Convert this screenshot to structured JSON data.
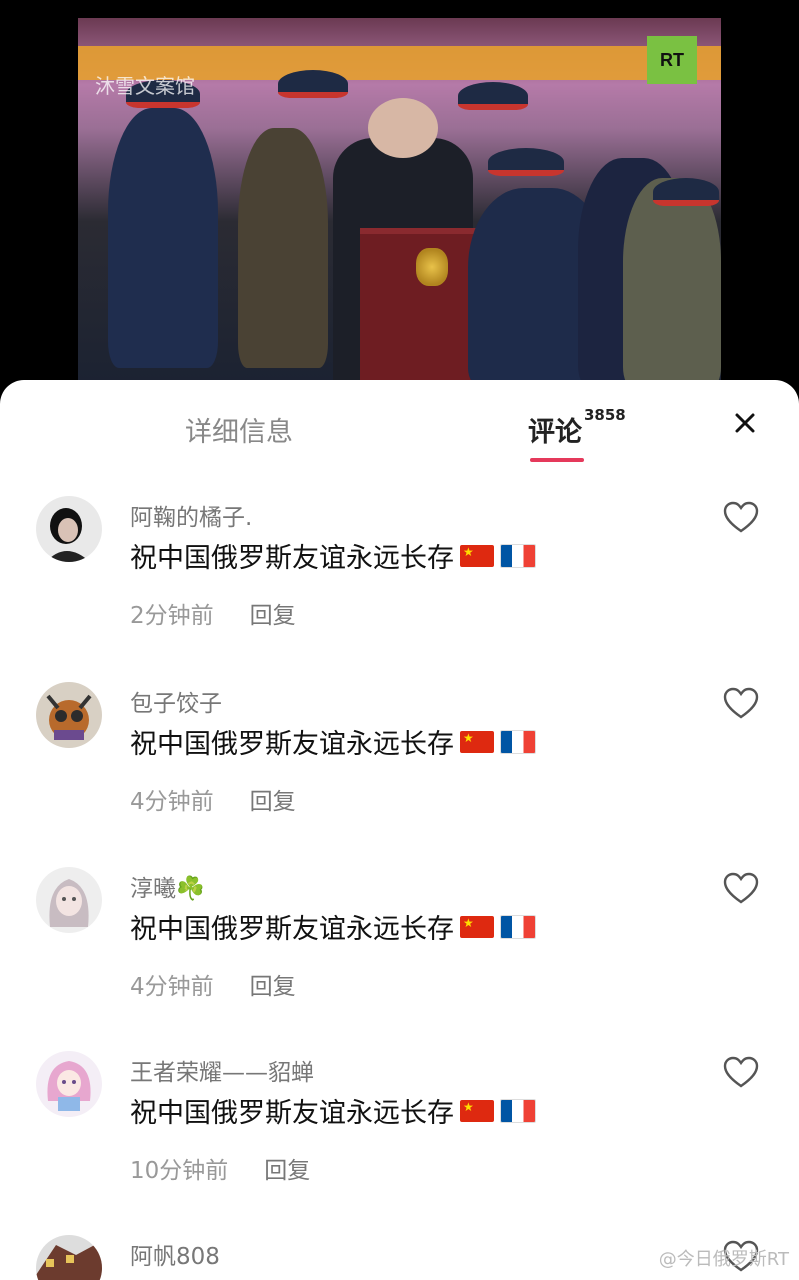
{
  "video": {
    "watermark": "沐雪文案馆",
    "logo": "RT"
  },
  "tabs": {
    "details_label": "详细信息",
    "comments_label": "评论",
    "comments_count": "3858"
  },
  "comments": [
    {
      "username": "阿鞠的橘子.",
      "text": "祝中国俄罗斯友谊永远长存",
      "flags": [
        "china-flag",
        "france-flag"
      ],
      "time": "2分钟前",
      "reply": "回复"
    },
    {
      "username": "包子饺子",
      "text": "祝中国俄罗斯友谊永远长存",
      "flags": [
        "china-flag",
        "france-flag"
      ],
      "time": "4分钟前",
      "reply": "回复"
    },
    {
      "username": "淳曦☘️",
      "text": "祝中国俄罗斯友谊永远长存",
      "flags": [
        "china-flag",
        "france-flag"
      ],
      "time": "4分钟前",
      "reply": "回复"
    },
    {
      "username": "王者荣耀——貂蝉",
      "text": "祝中国俄罗斯友谊永远长存",
      "flags": [
        "china-flag",
        "france-flag"
      ],
      "time": "10分钟前",
      "reply": "回复"
    },
    {
      "username": "阿帆808"
    }
  ],
  "footer_watermark": "@今日俄罗斯RT",
  "colors": {
    "accent": "#e5395b",
    "rt_green": "#7ac142"
  }
}
